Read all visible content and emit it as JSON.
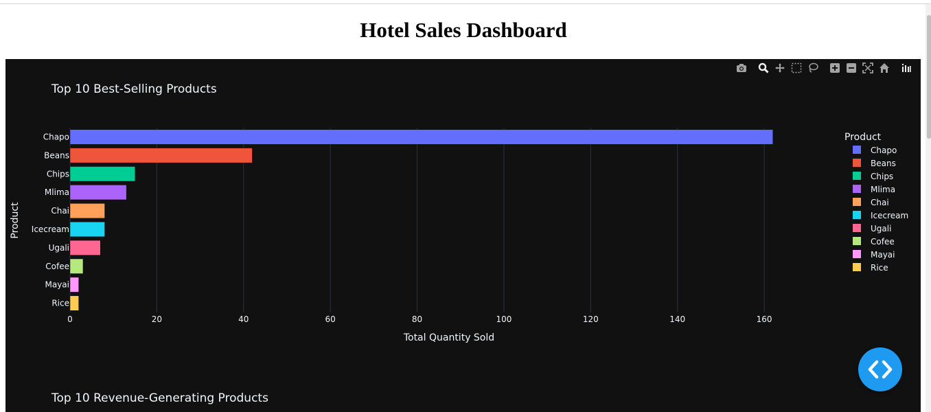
{
  "page": {
    "title": "Hotel Sales Dashboard"
  },
  "modebar": {
    "icons": [
      "camera-icon",
      "zoom-icon",
      "pan-icon",
      "box-select-icon",
      "lasso-icon",
      "zoom-in-icon",
      "zoom-out-icon",
      "autoscale-icon",
      "reset-axes-icon",
      "plotly-logo-icon"
    ]
  },
  "chart_data": [
    {
      "type": "bar",
      "orientation": "horizontal",
      "title": "Top 10 Best-Selling Products",
      "xlabel": "Total Quantity Sold",
      "ylabel": "Product",
      "categories": [
        "Chapo",
        "Beans",
        "Chips",
        "Mlima",
        "Chai",
        "Icecream",
        "Ugali",
        "Cofee",
        "Mayai",
        "Rice"
      ],
      "values": [
        162,
        42,
        15,
        13,
        8,
        8,
        7,
        3,
        2,
        2
      ],
      "colors": [
        "#636efa",
        "#ef553b",
        "#00cc96",
        "#ab63fa",
        "#ffa15a",
        "#19d3f3",
        "#ff6692",
        "#b6e880",
        "#ff97ff",
        "#fecb52"
      ],
      "xlim": [
        0,
        166
      ],
      "xticks": [
        0,
        20,
        40,
        60,
        80,
        100,
        120,
        140,
        160
      ],
      "grid": true,
      "legend": {
        "title": "Product",
        "placement": "right"
      }
    },
    {
      "type": "bar",
      "title": "Top 10 Revenue-Generating Products"
    }
  ],
  "fab": {
    "icon": "code-brackets-icon"
  }
}
